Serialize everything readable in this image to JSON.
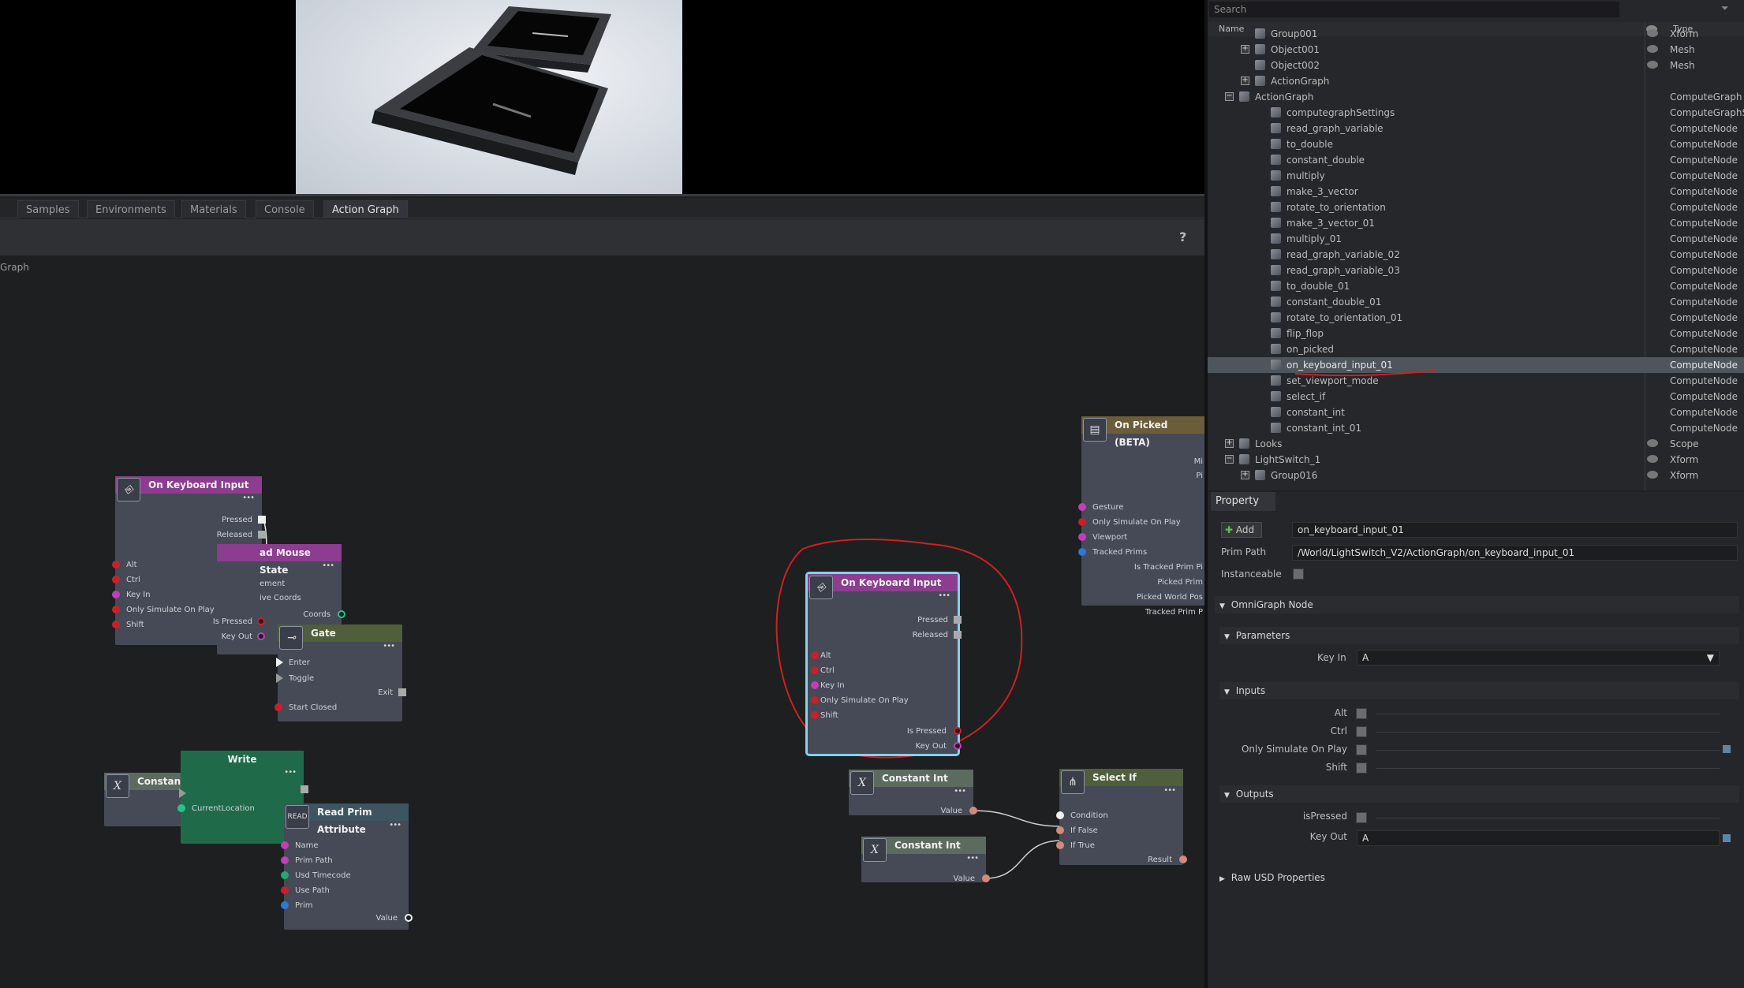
{
  "tabs": [
    "Samples",
    "Environments",
    "Materials",
    "Console",
    "Action Graph"
  ],
  "help_label": "?",
  "graph_label": "Graph",
  "nodes": {
    "kb1": {
      "title": "On Keyboard Input",
      "outputs": [
        "Pressed",
        "Released"
      ],
      "inputs": [
        "Alt",
        "Ctrl",
        "Key In",
        "Only Simulate On Play",
        "Shift"
      ],
      "outputs2": [
        "Is Pressed",
        "Key Out"
      ]
    },
    "mouse": {
      "title": "ad Mouse State",
      "rows": [
        "ement",
        "ive Coords",
        "Coords"
      ]
    },
    "gate": {
      "title": "Gate",
      "inputs": [
        "Enter",
        "Toggle",
        "Start Closed"
      ],
      "exit": "Exit"
    },
    "constant": {
      "title": "Constant"
    },
    "write": {
      "title": "Write",
      "input": "CurrentLocation"
    },
    "read": {
      "title": "Read Prim Attribute",
      "icon": "READ",
      "inputs": [
        "Name",
        "Prim Path",
        "Usd Timecode",
        "Use Path",
        "Prim"
      ],
      "value": "Value"
    },
    "kb2": {
      "title": "On Keyboard Input",
      "outputs": [
        "Pressed",
        "Released"
      ],
      "inputs": [
        "Alt",
        "Ctrl",
        "Key In",
        "Only Simulate On Play",
        "Shift"
      ],
      "outputs2": [
        "Is Pressed",
        "Key Out"
      ]
    },
    "ci1": {
      "title": "Constant Int",
      "value": "Value"
    },
    "ci2": {
      "title": "Constant Int",
      "value": "Value"
    },
    "selectif": {
      "title": "Select If",
      "inputs": [
        "Condition",
        "If False",
        "If True"
      ],
      "result": "Result"
    },
    "onpicked": {
      "title": "On Picked (BETA)",
      "top_outputs": [
        "Mi",
        "Pi"
      ],
      "inputs": [
        "Gesture",
        "Only Simulate On Play",
        "Viewport",
        "Tracked Prims"
      ],
      "outputs": [
        "Is Tracked Prim Pi",
        "Picked Prim",
        "Picked World Pos",
        "Tracked Prim P"
      ]
    },
    "x_glyph": "X",
    "ellipsis": "•••"
  },
  "stage": {
    "search_placeholder": "Search",
    "col_name": "Name",
    "col_type": "Type",
    "rows": [
      {
        "name": "Group001",
        "type": "Xform"
      },
      {
        "name": "Object001",
        "type": "Mesh"
      },
      {
        "name": "Object002",
        "type": "Mesh"
      },
      {
        "name": "ActionGraph",
        "type": ""
      },
      {
        "name": "ActionGraph",
        "type": "ComputeGraph"
      },
      {
        "name": "computegraphSettings",
        "type": "ComputeGraphS"
      },
      {
        "name": "read_graph_variable",
        "type": "ComputeNode"
      },
      {
        "name": "to_double",
        "type": "ComputeNode"
      },
      {
        "name": "constant_double",
        "type": "ComputeNode"
      },
      {
        "name": "multiply",
        "type": "ComputeNode"
      },
      {
        "name": "make_3_vector",
        "type": "ComputeNode"
      },
      {
        "name": "rotate_to_orientation",
        "type": "ComputeNode"
      },
      {
        "name": "make_3_vector_01",
        "type": "ComputeNode"
      },
      {
        "name": "multiply_01",
        "type": "ComputeNode"
      },
      {
        "name": "read_graph_variable_02",
        "type": "ComputeNode"
      },
      {
        "name": "read_graph_variable_03",
        "type": "ComputeNode"
      },
      {
        "name": "to_double_01",
        "type": "ComputeNode"
      },
      {
        "name": "constant_double_01",
        "type": "ComputeNode"
      },
      {
        "name": "rotate_to_orientation_01",
        "type": "ComputeNode"
      },
      {
        "name": "flip_flop",
        "type": "ComputeNode"
      },
      {
        "name": "on_picked",
        "type": "ComputeNode"
      },
      {
        "name": "on_keyboard_input_01",
        "type": "ComputeNode"
      },
      {
        "name": "set_viewport_mode",
        "type": "ComputeNode"
      },
      {
        "name": "select_if",
        "type": "ComputeNode"
      },
      {
        "name": "constant_int",
        "type": "ComputeNode"
      },
      {
        "name": "constant_int_01",
        "type": "ComputeNode"
      },
      {
        "name": "Looks",
        "type": "Scope"
      },
      {
        "name": "LightSwitch_1",
        "type": "Xform"
      },
      {
        "name": "Group016",
        "type": "Xform"
      }
    ]
  },
  "property": {
    "tab": "Property",
    "add_label": "Add",
    "name_value": "on_keyboard_input_01",
    "prim_path_label": "Prim Path",
    "prim_path_value": "/World/LightSwitch_V2/ActionGraph/on_keyboard_input_01",
    "instanceable_label": "Instanceable",
    "omnigraph_label": "OmniGraph Node",
    "parameters_label": "Parameters",
    "key_in_label": "Key In",
    "key_in_value": "A",
    "inputs_label": "Inputs",
    "inputs": [
      "Alt",
      "Ctrl",
      "Only Simulate On Play",
      "Shift"
    ],
    "outputs_label": "Outputs",
    "is_pressed_label": "isPressed",
    "key_out_label": "Key Out",
    "key_out_value": "A",
    "raw_usd_label": "Raw USD Properties"
  },
  "colors": {
    "accent_selection": "#7fd4f0",
    "annotation": "#d02020"
  }
}
